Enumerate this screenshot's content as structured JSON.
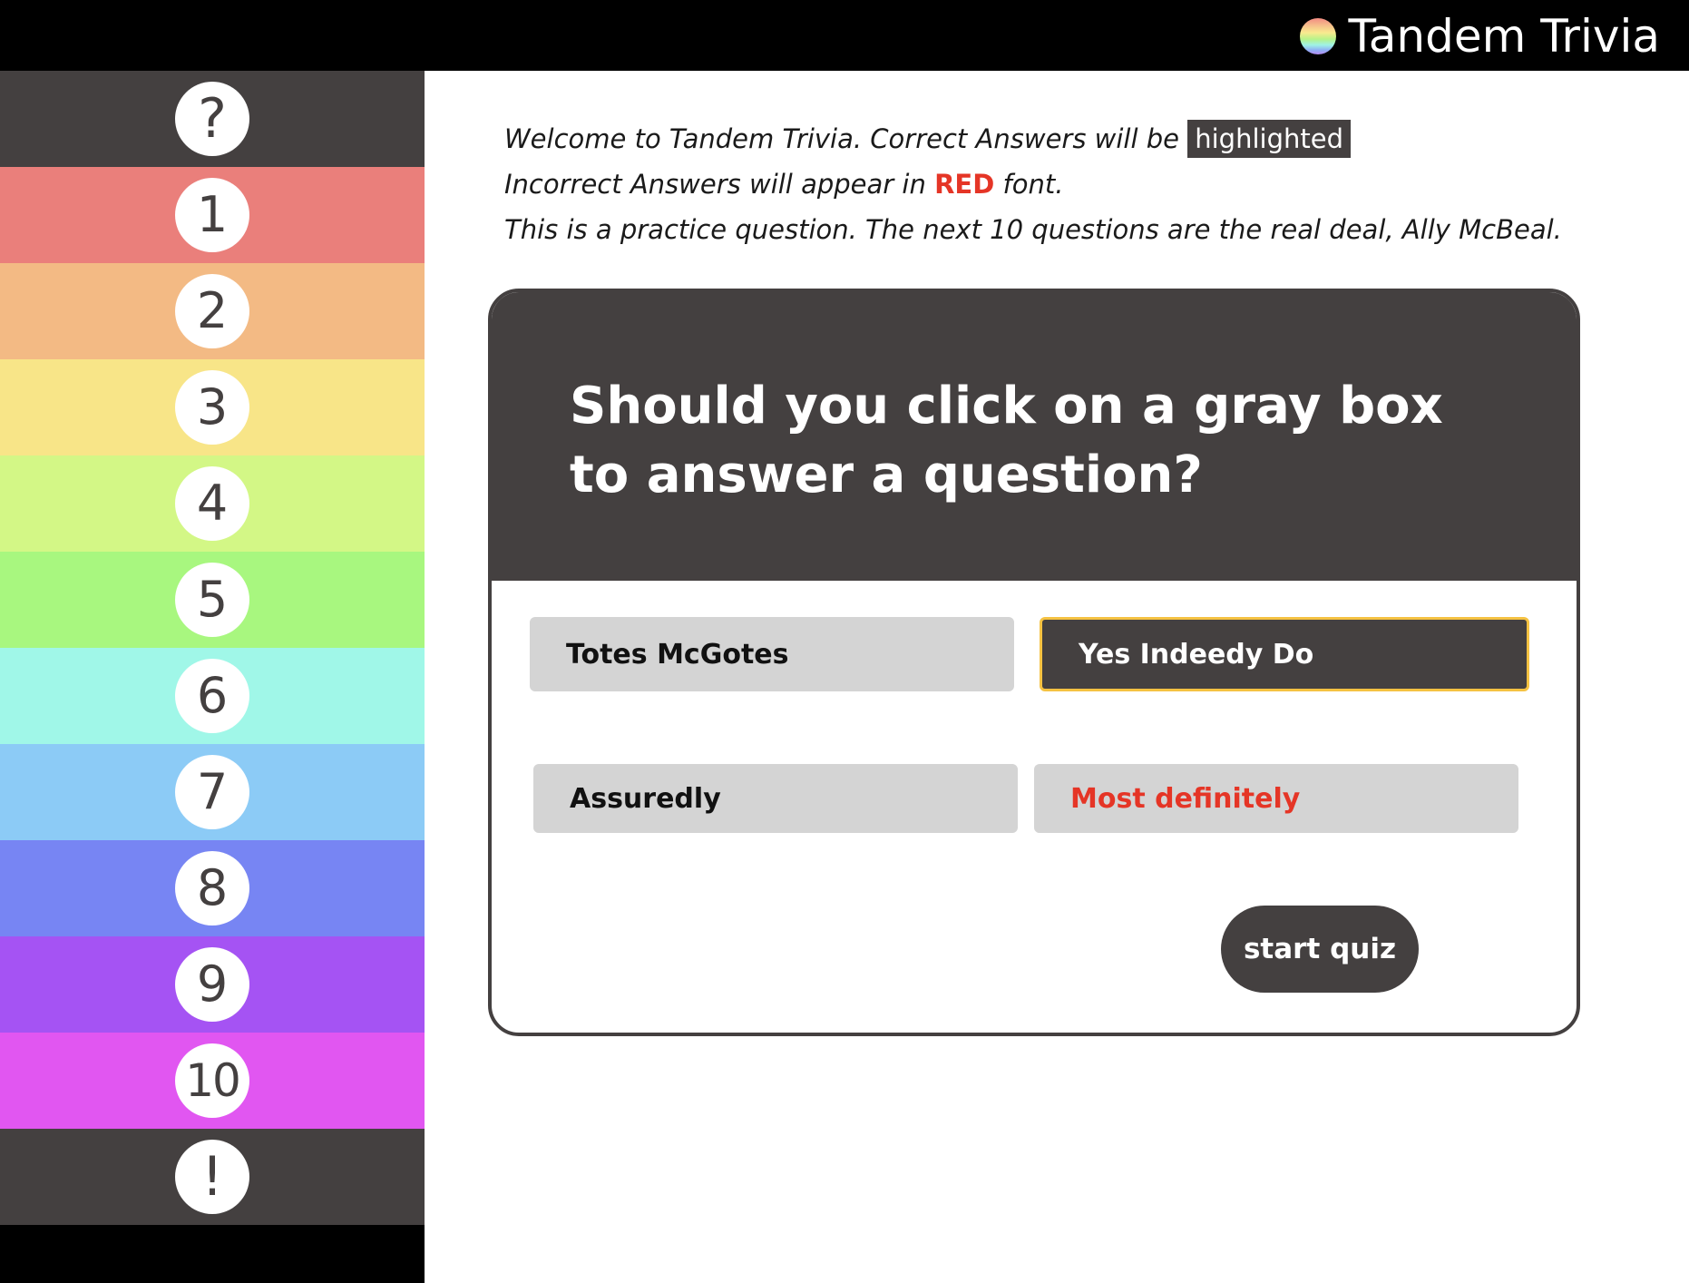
{
  "app": {
    "title": "Tandem Trivia",
    "logo_icon": "rainbow-circle-icon"
  },
  "sidebar": {
    "items": [
      {
        "label": "?",
        "color": "#444040"
      },
      {
        "label": "1",
        "color": "#ea7f7b"
      },
      {
        "label": "2",
        "color": "#f3ba84"
      },
      {
        "label": "3",
        "color": "#f8e588"
      },
      {
        "label": "4",
        "color": "#d3f786"
      },
      {
        "label": "5",
        "color": "#a8f77f"
      },
      {
        "label": "6",
        "color": "#a0f7e8"
      },
      {
        "label": "7",
        "color": "#8ccbf6"
      },
      {
        "label": "8",
        "color": "#7785f3"
      },
      {
        "label": "9",
        "color": "#a553f3"
      },
      {
        "label": "10",
        "color": "#e156f1"
      },
      {
        "label": "!",
        "color": "#444040"
      }
    ]
  },
  "intro": {
    "line1_pre": "Welcome to Tandem Trivia. Correct Answers will be ",
    "line1_highlight": "highlighted",
    "line2_pre": "Incorrect Answers will appear in ",
    "line2_red": "RED",
    "line2_post": " font.",
    "line3": "This is a practice question. The next 10 questions are the real deal, Ally McBeal."
  },
  "question": {
    "text": "Should you click on a gray box to answer a question?",
    "answers": [
      {
        "label": "Totes McGotes",
        "state": "default"
      },
      {
        "label": "Yes Indeedy Do",
        "state": "correct"
      },
      {
        "label": "Assuredly",
        "state": "default"
      },
      {
        "label": "Most definitely",
        "state": "incorrect"
      }
    ],
    "start_label": "start quiz"
  },
  "colors": {
    "dark": "#444040",
    "incorrect": "#e53526",
    "highlight_border": "#f5c242"
  }
}
